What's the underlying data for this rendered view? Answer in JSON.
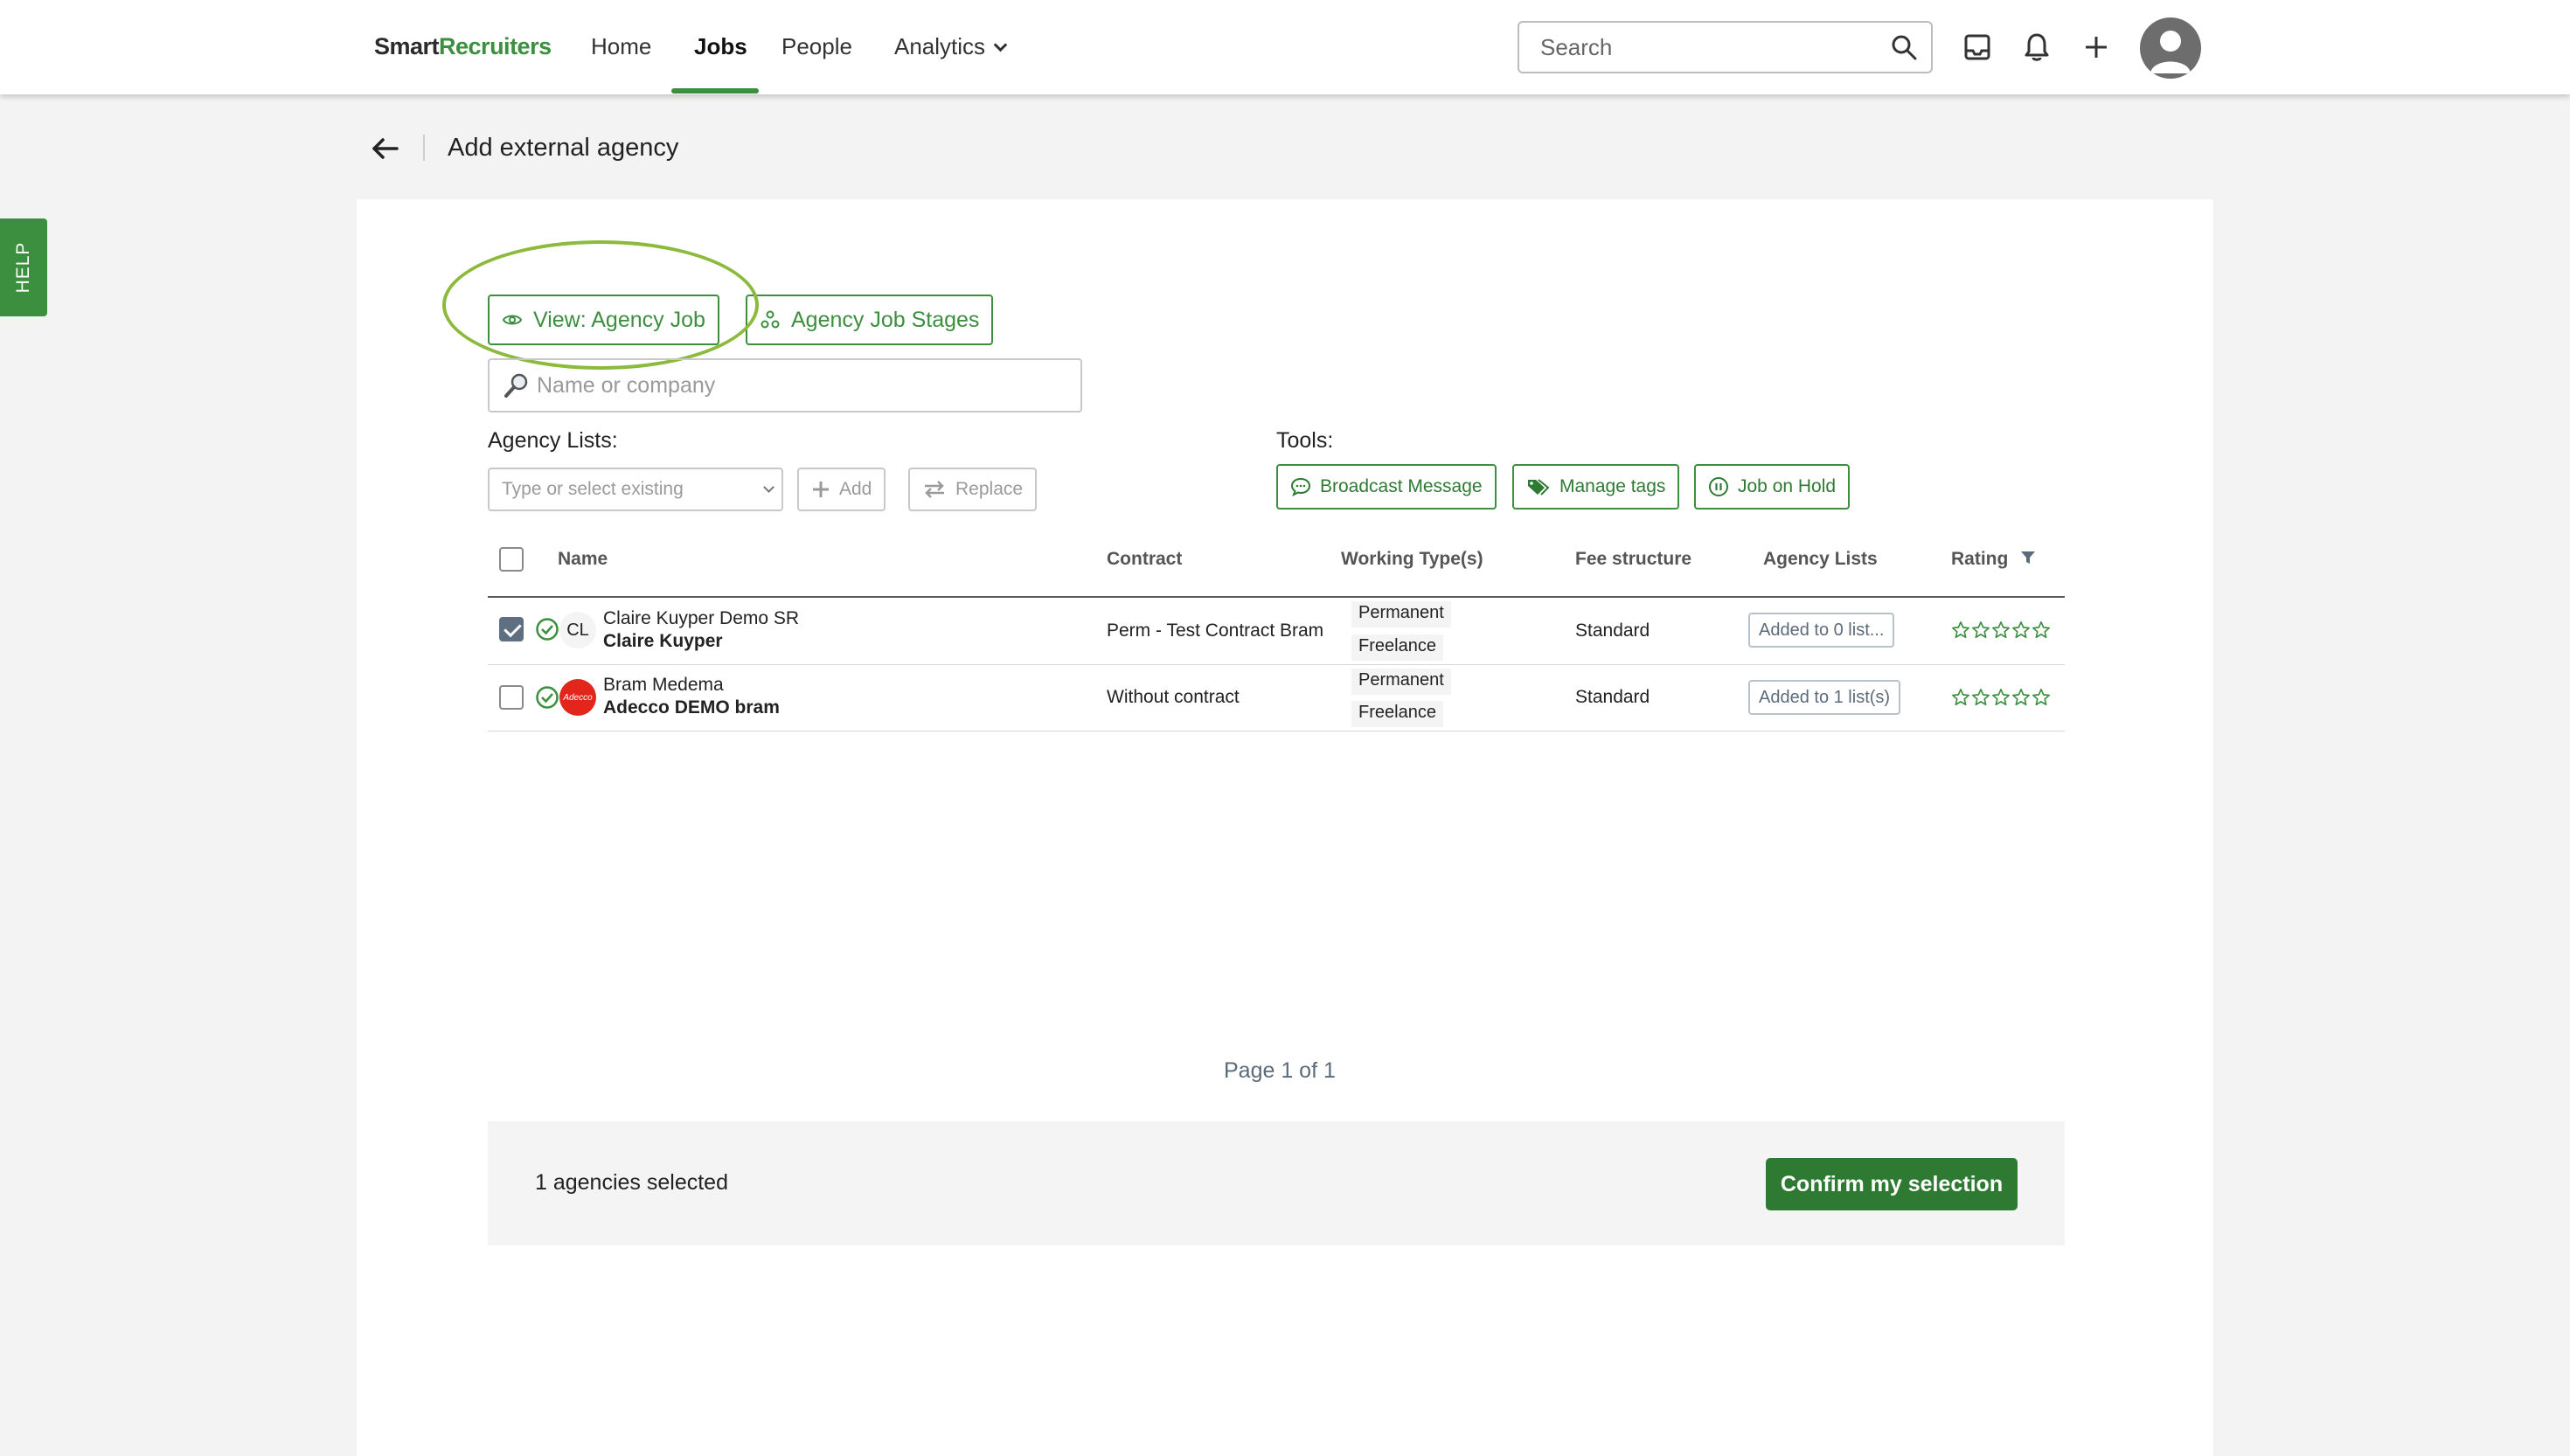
{
  "app": {
    "logo_part1": "Smart",
    "logo_part2": "Recruiters"
  },
  "nav": {
    "home": "Home",
    "jobs": "Jobs",
    "people": "People",
    "analytics": "Analytics",
    "active_tab": "Jobs",
    "search_placeholder": "Search",
    "icons": [
      "inbox-icon",
      "bell-icon",
      "plus-icon",
      "avatar"
    ]
  },
  "page": {
    "title": "Add external agency"
  },
  "help_tab": "HELP",
  "actions": {
    "view_agency_job": "View: Agency Job",
    "agency_job_stages": "Agency Job Stages"
  },
  "name_search": {
    "placeholder": "Name or company"
  },
  "agency_lists": {
    "label": "Agency Lists:",
    "select_placeholder": "Type or select existing",
    "add": "Add",
    "replace": "Replace"
  },
  "tools": {
    "label": "Tools:",
    "broadcast": "Broadcast Message",
    "manage_tags": "Manage tags",
    "job_on_hold": "Job on Hold"
  },
  "table": {
    "headers": {
      "name": "Name",
      "contract": "Contract",
      "working_types": "Working Type(s)",
      "fee_structure": "Fee structure",
      "agency_lists": "Agency Lists",
      "rating": "Rating"
    },
    "rows": [
      {
        "checked": true,
        "avatar_initials": "CL",
        "company": "Claire Kuyper Demo SR",
        "contact": "Claire Kuyper",
        "contract": "Perm - Test Contract Bram",
        "working_types": [
          "Permanent",
          "Freelance"
        ],
        "fee_structure": "Standard",
        "agency_lists": "Added to 0 list...",
        "rating": 0
      },
      {
        "checked": false,
        "avatar_logo_text": "Adecco",
        "company": "Bram Medema",
        "contact": "Adecco DEMO bram",
        "contract": "Without contract",
        "working_types": [
          "Permanent",
          "Freelance"
        ],
        "fee_structure": "Standard",
        "agency_lists": "Added to 1 list(s)",
        "rating": 0
      }
    ]
  },
  "pager": "Page 1 of 1",
  "footer": {
    "selected": "1 agencies selected",
    "confirm": "Confirm my selection"
  },
  "colors": {
    "brand_green": "#3c8f3f",
    "annotation": "#8cba3d",
    "checkbox_checked": "#5f6f82"
  }
}
